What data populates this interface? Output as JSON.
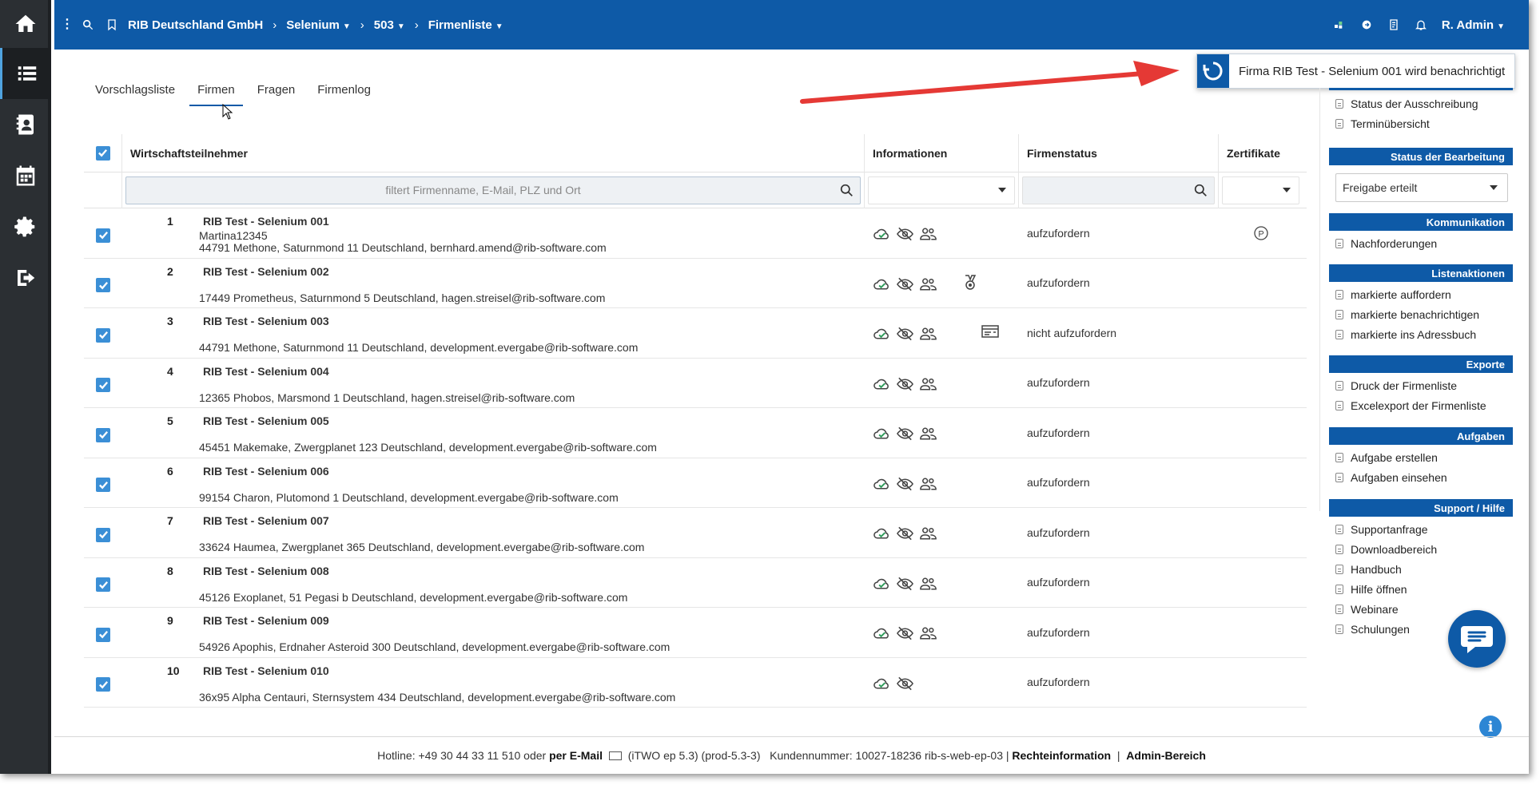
{
  "topbar": {
    "breadcrumbs": [
      {
        "label": "RIB Deutschland GmbH",
        "caret": false
      },
      {
        "label": "Selenium",
        "caret": true
      },
      {
        "label": "503",
        "caret": true
      },
      {
        "label": "Firmenliste",
        "caret": true
      }
    ],
    "user": "R. Admin"
  },
  "tabs": [
    "Vorschlagsliste",
    "Firmen",
    "Fragen",
    "Firmenlog"
  ],
  "active_tab": "Firmen",
  "toast": {
    "message": "Firma RIB Test - Selenium 001 wird benachrichtigt"
  },
  "table": {
    "headers": {
      "main": "Wirtschaftsteilnehmer",
      "info": "Informationen",
      "status": "Firmenstatus",
      "cert": "Zertifikate"
    },
    "filter_placeholder": "filtert Firmenname, E-Mail, PLZ und Ort",
    "rows": [
      {
        "num": "1",
        "name": "RIB Test - Selenium 001",
        "login": "Martina12345",
        "address": "44791 Methone, Saturnmond 11 Deutschland, bernhard.amend@rib-software.com",
        "status": "aufzufordern",
        "icons": 3,
        "extra": "",
        "cert": "P"
      },
      {
        "num": "2",
        "name": "RIB Test - Selenium 002",
        "login": "",
        "address": "17449 Prometheus, Saturnmond 5 Deutschland, hagen.streisel@rib-software.com",
        "status": "aufzufordern",
        "icons": 3,
        "extra": "medal",
        "cert": ""
      },
      {
        "num": "3",
        "name": "RIB Test - Selenium 003",
        "login": "",
        "address": "44791 Methone, Saturnmond 11 Deutschland, development.evergabe@rib-software.com",
        "status": "nicht aufzufordern",
        "icons": 3,
        "extra": "card",
        "cert": ""
      },
      {
        "num": "4",
        "name": "RIB Test - Selenium 004",
        "login": "",
        "address": "12365 Phobos, Marsmond 1 Deutschland, hagen.streisel@rib-software.com",
        "status": "aufzufordern",
        "icons": 3,
        "extra": "",
        "cert": ""
      },
      {
        "num": "5",
        "name": "RIB Test - Selenium 005",
        "login": "",
        "address": "45451 Makemake, Zwergplanet 123 Deutschland, development.evergabe@rib-software.com",
        "status": "aufzufordern",
        "icons": 3,
        "extra": "",
        "cert": ""
      },
      {
        "num": "6",
        "name": "RIB Test - Selenium 006",
        "login": "",
        "address": "99154 Charon, Plutomond 1 Deutschland, development.evergabe@rib-software.com",
        "status": "aufzufordern",
        "icons": 3,
        "extra": "",
        "cert": ""
      },
      {
        "num": "7",
        "name": "RIB Test - Selenium 007",
        "login": "",
        "address": "33624 Haumea, Zwergplanet 365 Deutschland, development.evergabe@rib-software.com",
        "status": "aufzufordern",
        "icons": 3,
        "extra": "",
        "cert": ""
      },
      {
        "num": "8",
        "name": "RIB Test - Selenium 008",
        "login": "",
        "address": "45126 Exoplanet, 51 Pegasi b Deutschland, development.evergabe@rib-software.com",
        "status": "aufzufordern",
        "icons": 3,
        "extra": "",
        "cert": ""
      },
      {
        "num": "9",
        "name": "RIB Test - Selenium 009",
        "login": "",
        "address": "54926 Apophis, Erdnaher Asteroid 300 Deutschland, development.evergabe@rib-software.com",
        "status": "aufzufordern",
        "icons": 3,
        "extra": "",
        "cert": ""
      },
      {
        "num": "10",
        "name": "RIB Test - Selenium 010",
        "login": "",
        "address": "36x95 Alpha Centauri, Sternsystem 434 Deutschland, development.evergabe@rib-software.com",
        "status": "aufzufordern",
        "icons": 2,
        "extra": "",
        "cert": ""
      }
    ]
  },
  "panel": {
    "top_items": [
      "Status der Ausschreibung",
      "Terminübersicht"
    ],
    "bearbeitung": {
      "title": "Status der Bearbeitung",
      "select_value": "Freigabe erteilt"
    },
    "kommunikation": {
      "title": "Kommunikation",
      "items": [
        "Nachforderungen"
      ]
    },
    "listenaktionen": {
      "title": "Listenaktionen",
      "items": [
        "markierte auffordern",
        "markierte benachrichtigen",
        "markierte ins Adressbuch"
      ]
    },
    "exporte": {
      "title": "Exporte",
      "items": [
        "Druck der Firmenliste",
        "Excelexport der Firmenliste"
      ]
    },
    "aufgaben": {
      "title": "Aufgaben",
      "items": [
        "Aufgabe erstellen",
        "Aufgaben einsehen"
      ]
    },
    "support": {
      "title": "Support / Hilfe",
      "items": [
        "Supportanfrage",
        "Downloadbereich",
        "Handbuch",
        "Hilfe öffnen",
        "Webinare",
        "Schulungen"
      ]
    }
  },
  "footer": {
    "hotline": "Hotline: +49 30 44 33 11 510 oder",
    "email_label": "per E-Mail",
    "version": "(iTWO ep 5.3) (prod-5.3-3)   Kundennummer: 10027-18236 rib-s-web-ep-03 |",
    "legal": "Rechteinformation",
    "sep": "|",
    "admin": "Admin-Bereich"
  },
  "colors": {
    "brand": "#0e5aa7",
    "rail": "#2b2f33",
    "checkbox": "#3b8fd6",
    "arrow": "#e53935",
    "cloud_ok": "#2e9c5a"
  }
}
